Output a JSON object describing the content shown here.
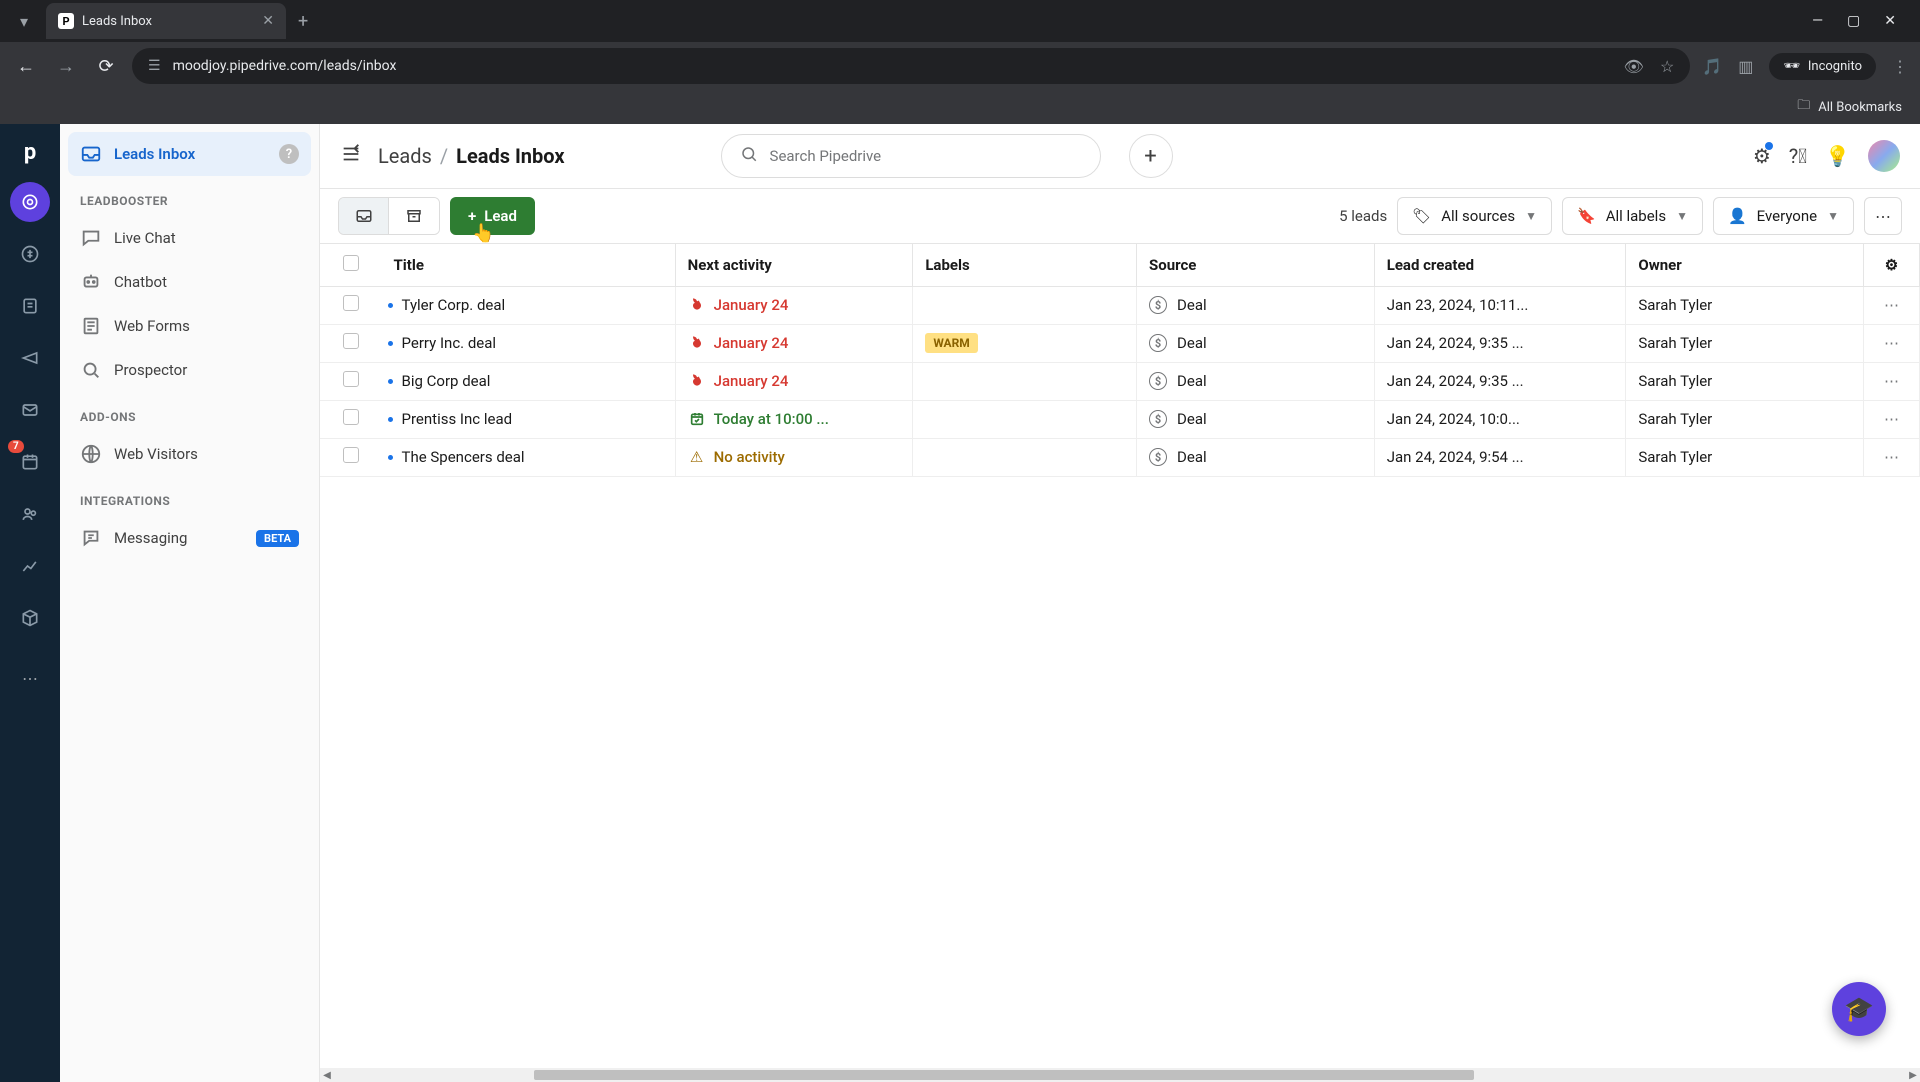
{
  "browser": {
    "tab_title": "Leads Inbox",
    "url": "moodjoy.pipedrive.com/leads/inbox",
    "incognito": "Incognito",
    "bookmarks": "All Bookmarks"
  },
  "rail": {
    "badge": "7"
  },
  "sidebar": {
    "inbox": "Leads Inbox",
    "heading1": "LEADBOOSTER",
    "live_chat": "Live Chat",
    "chatbot": "Chatbot",
    "web_forms": "Web Forms",
    "prospector": "Prospector",
    "heading2": "ADD-ONS",
    "web_visitors": "Web Visitors",
    "heading3": "INTEGRATIONS",
    "messaging": "Messaging",
    "beta": "BETA"
  },
  "topbar": {
    "crumb1": "Leads",
    "crumb2": "Leads Inbox",
    "search_placeholder": "Search Pipedrive"
  },
  "actionbar": {
    "lead_btn": "Lead",
    "count": "5 leads",
    "filter_sources": "All sources",
    "filter_labels": "All labels",
    "filter_owner": "Everyone"
  },
  "columns": {
    "title": "Title",
    "next_activity": "Next activity",
    "labels": "Labels",
    "source": "Source",
    "created": "Lead created",
    "owner": "Owner"
  },
  "rows": [
    {
      "title": "Tyler Corp. deal",
      "activity": "January 24",
      "act_type": "red",
      "label": "",
      "source": "Deal",
      "created": "Jan 23, 2024, 10:11...",
      "owner": "Sarah Tyler"
    },
    {
      "title": "Perry Inc. deal",
      "activity": "January 24",
      "act_type": "red",
      "label": "WARM",
      "source": "Deal",
      "created": "Jan 24, 2024, 9:35 ...",
      "owner": "Sarah Tyler"
    },
    {
      "title": "Big Corp deal",
      "activity": "January 24",
      "act_type": "red",
      "label": "",
      "source": "Deal",
      "created": "Jan 24, 2024, 9:35 ...",
      "owner": "Sarah Tyler"
    },
    {
      "title": "Prentiss Inc lead",
      "activity": "Today at 10:00 ...",
      "act_type": "green",
      "label": "",
      "source": "Deal",
      "created": "Jan 24, 2024, 10:0...",
      "owner": "Sarah Tyler"
    },
    {
      "title": "The Spencers deal",
      "activity": "No activity",
      "act_type": "warn",
      "label": "",
      "source": "Deal",
      "created": "Jan 24, 2024, 9:54 ...",
      "owner": "Sarah Tyler"
    }
  ]
}
